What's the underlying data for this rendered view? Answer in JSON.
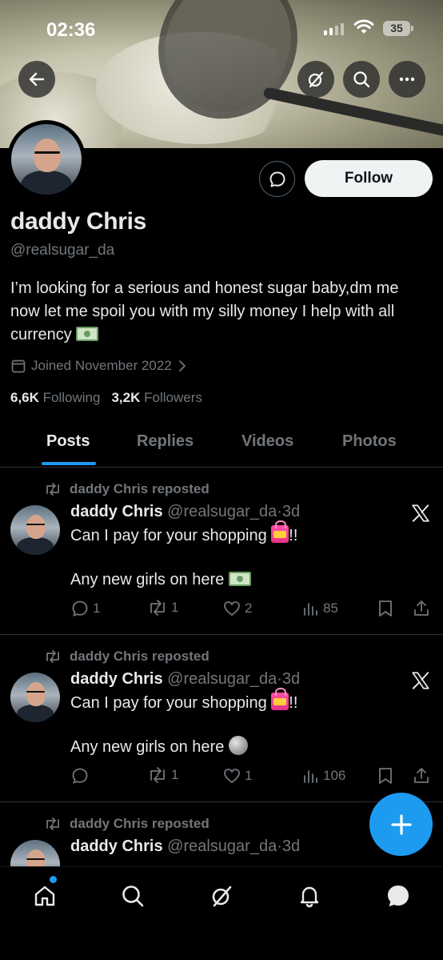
{
  "status_bar": {
    "time": "02:36",
    "battery": "35"
  },
  "header": {
    "back_icon": "arrow-left-icon",
    "actions": [
      "grok-icon",
      "search-icon",
      "more-icon"
    ]
  },
  "profile": {
    "name": "daddy Chris",
    "handle": "@realsugar_da",
    "bio": "I’m looking for a serious and honest sugar baby,dm me now let me spoil you with my silly money I help with all currency",
    "joined": "Joined November 2022",
    "following_count": "6,6K",
    "following_label": "Following",
    "followers_count": "3,2K",
    "followers_label": "Followers",
    "follow_label": "Follow"
  },
  "tabs": [
    {
      "label": "Posts",
      "active": true
    },
    {
      "label": "Replies",
      "active": false
    },
    {
      "label": "Videos",
      "active": false
    },
    {
      "label": "Photos",
      "active": false
    }
  ],
  "posts": [
    {
      "repost_label": "daddy Chris reposted",
      "author": "daddy Chris",
      "handle": "@realsugar_da",
      "sep": "·",
      "age": "3d",
      "line1": "Can I pay for your shopping",
      "line1_suffix": "!!",
      "line2": "Any new girls on here",
      "replies": "1",
      "reposts": "1",
      "likes": "2",
      "views": "85"
    },
    {
      "repost_label": "daddy Chris reposted",
      "author": "daddy Chris",
      "handle": "@realsugar_da",
      "sep": "·",
      "age": "3d",
      "line1": "Can I pay for your shopping",
      "line1_suffix": "!!",
      "line2": "Any new girls on here",
      "replies": "",
      "reposts": "1",
      "likes": "1",
      "views": "106"
    },
    {
      "repost_label": "daddy Chris reposted",
      "author": "daddy Chris",
      "handle": "@realsugar_da",
      "sep": "·",
      "age": "3d"
    }
  ],
  "bottom_nav": [
    "home-icon",
    "search-icon",
    "grok-icon",
    "notifications-icon",
    "messages-icon"
  ],
  "colors": {
    "accent": "#1d9bf0",
    "muted": "#71767b",
    "text": "#e7e9ea",
    "divider": "#2f3336"
  }
}
